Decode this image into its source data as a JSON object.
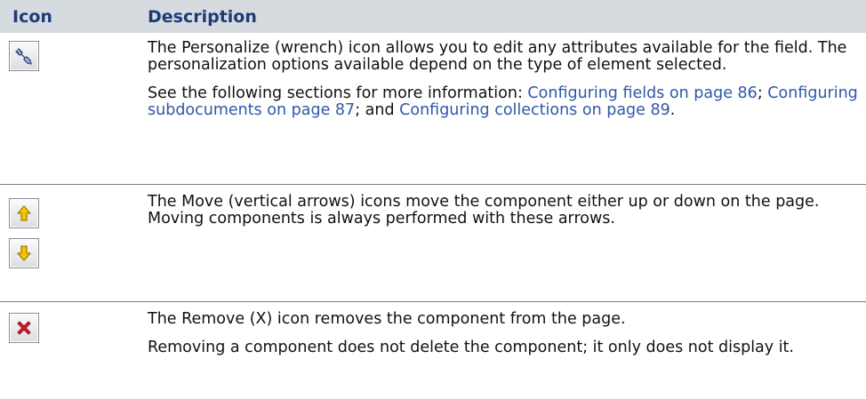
{
  "header": {
    "icon_col": "Icon",
    "desc_col": "Description"
  },
  "rows": [
    {
      "icons": [
        "wrench-icon"
      ],
      "p1": "The Personalize (wrench) icon allows you to edit any attributes available for the field. The personalization options available depend on the type of element selected.",
      "p2": {
        "lead": "See the following sections for more information: ",
        "link1": "Configuring fields on page 86",
        "sep1": "; ",
        "link2": "Configuring subdocuments on page 87",
        "sep2": "; and ",
        "link3": "Configuring collections on page 89",
        "end": "."
      }
    },
    {
      "icons": [
        "arrow-up-icon",
        "arrow-down-icon"
      ],
      "p1": "The Move (vertical arrows) icons move the component either up or down on the page. Moving components is always performed with these arrows."
    },
    {
      "icons": [
        "remove-x-icon"
      ],
      "p1": "The Remove (X) icon removes the component from the page.",
      "p2": "Removing a component does not delete the component; it only does not display it."
    }
  ],
  "colors": {
    "header_bg": "#d6dbe0",
    "header_text": "#1d3b78",
    "link": "#2f58a6",
    "arrow_fill": "#f5c400",
    "remove_fill": "#d81e2c"
  }
}
